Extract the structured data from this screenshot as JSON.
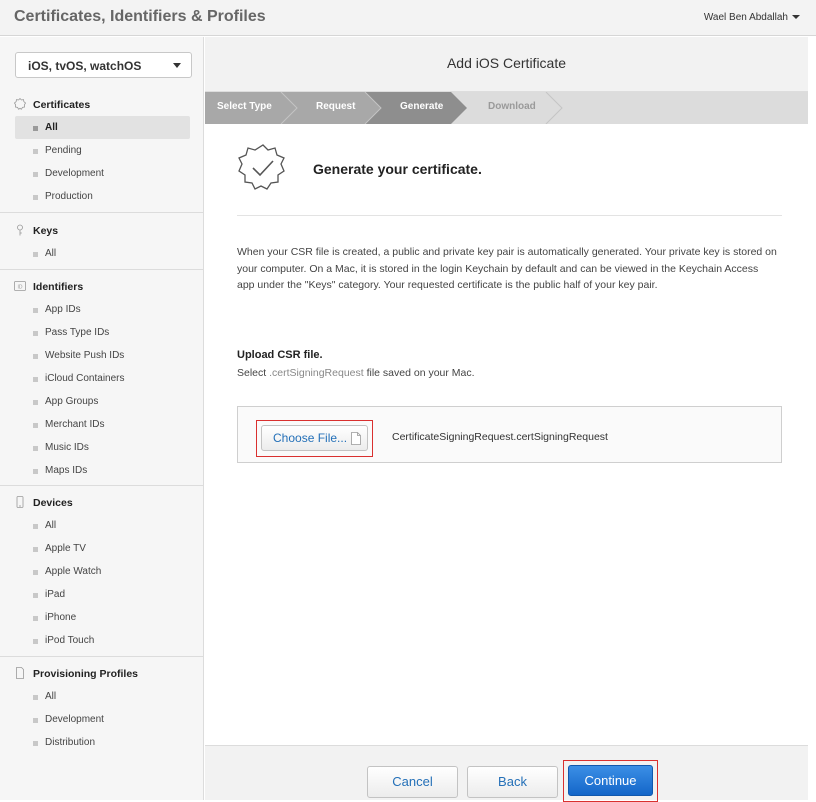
{
  "header": {
    "app_title": "Certificates, Identifiers & Profiles",
    "user_name": "Wael Ben Abdallah"
  },
  "sidebar": {
    "platform": "iOS, tvOS, watchOS",
    "sections": [
      {
        "title": "Certificates",
        "icon": "certificate-icon",
        "items": [
          "All",
          "Pending",
          "Development",
          "Production"
        ],
        "active": "All"
      },
      {
        "title": "Keys",
        "icon": "key-icon",
        "items": [
          "All"
        ]
      },
      {
        "title": "Identifiers",
        "icon": "id-icon",
        "items": [
          "App IDs",
          "Pass Type IDs",
          "Website Push IDs",
          "iCloud Containers",
          "App Groups",
          "Merchant IDs",
          "Music IDs",
          "Maps IDs"
        ]
      },
      {
        "title": "Devices",
        "icon": "device-icon",
        "items": [
          "All",
          "Apple TV",
          "Apple Watch",
          "iPad",
          "iPhone",
          "iPod Touch"
        ]
      },
      {
        "title": "Provisioning Profiles",
        "icon": "document-icon",
        "items": [
          "All",
          "Development",
          "Distribution"
        ]
      }
    ]
  },
  "main": {
    "title": "Add iOS Certificate",
    "steps": [
      {
        "label": "Select Type",
        "state": "done"
      },
      {
        "label": "Request",
        "state": "done"
      },
      {
        "label": "Generate",
        "state": "current"
      },
      {
        "label": "Download",
        "state": "pending"
      }
    ],
    "hero_title": "Generate your certificate.",
    "paragraph": "When your CSR file is created, a public and private key pair is automatically generated. Your private key is stored on your computer. On a Mac, it is stored in the login Keychain by default and can be viewed in the Keychain Access app under the \"Keys\" category. Your requested certificate is the public half of your key pair.",
    "upload_title": "Upload CSR file.",
    "upload_sub_pre": "Select ",
    "upload_sub_ext": ".certSigningRequest",
    "upload_sub_post": " file saved on your Mac.",
    "choose_file_label": "Choose File...",
    "file_name": "CertificateSigningRequest.certSigningRequest"
  },
  "footer": {
    "cancel_label": "Cancel",
    "back_label": "Back",
    "continue_label": "Continue"
  },
  "colors": {
    "accent": "#1466c9",
    "highlight_outline": "#d9302f",
    "step_done": "#a8a8a8",
    "step_current": "#8e8e8e",
    "step_pending": "#dcdcdc"
  }
}
